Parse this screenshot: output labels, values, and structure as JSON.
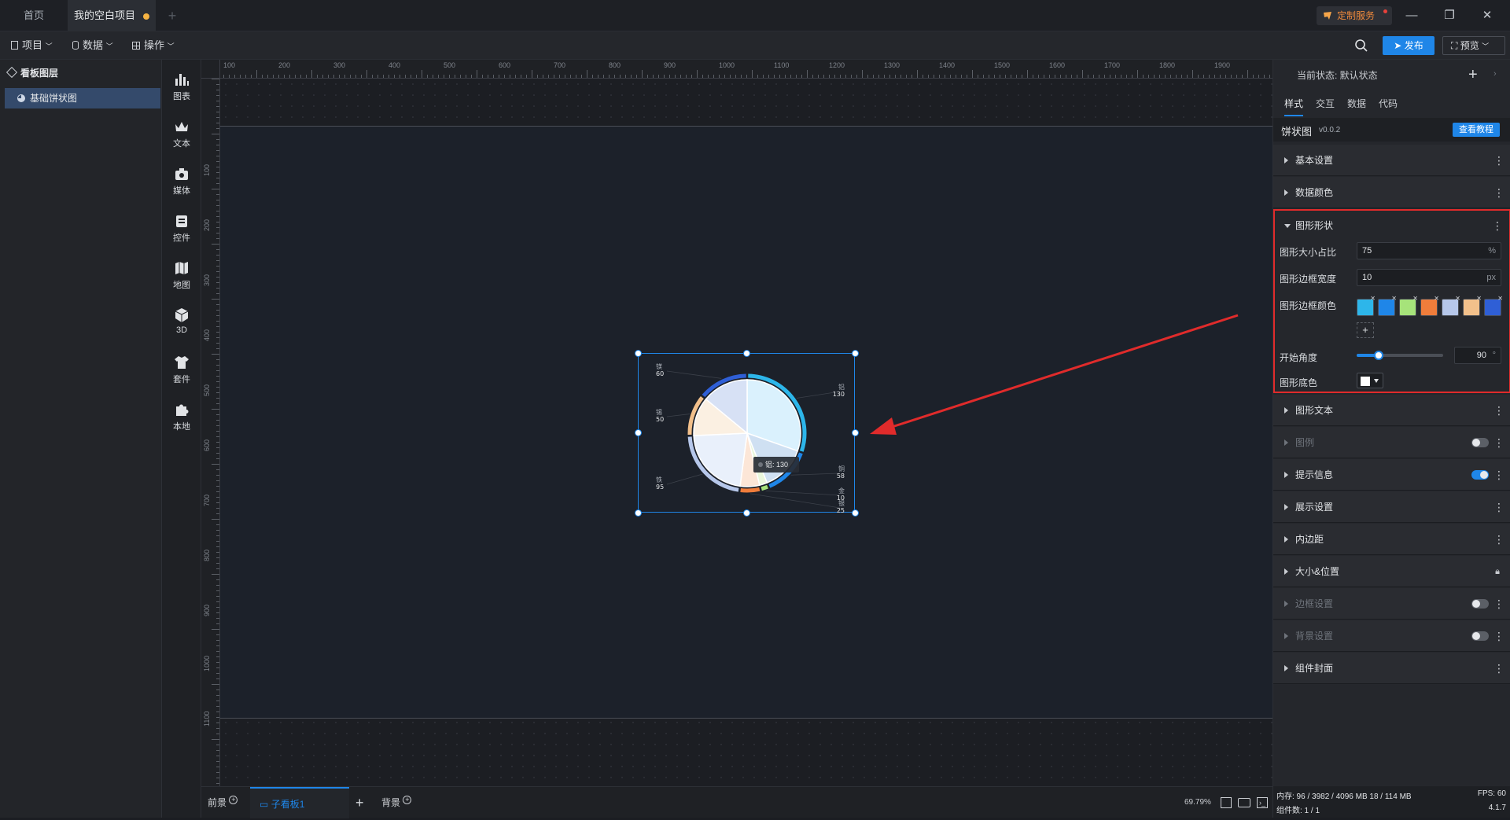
{
  "tabs": {
    "home": "首页",
    "project": "我的空白项目",
    "add": "+"
  },
  "titlebar": {
    "custom_service": "定制服务"
  },
  "toolbar": {
    "menus": [
      "项目",
      "数据",
      "操作"
    ],
    "publish": "发布",
    "preview": "预览"
  },
  "layers": {
    "title": "看板图层",
    "item": "基础饼状图"
  },
  "components": [
    "图表",
    "文本",
    "媒体",
    "控件",
    "地图",
    "3D",
    "套件",
    "本地"
  ],
  "ruler": {
    "top": [
      "100",
      "200",
      "300",
      "400",
      "500",
      "600",
      "700",
      "800",
      "900",
      "1000",
      "1100",
      "1200",
      "1300",
      "1400",
      "1500",
      "1600",
      "1700",
      "1800",
      "1900"
    ],
    "left": [
      "100",
      "200",
      "300",
      "400",
      "500",
      "600",
      "700",
      "800",
      "900",
      "1000",
      "1100"
    ]
  },
  "chart_data": {
    "type": "pie",
    "labels": [
      "铝",
      "铜",
      "金",
      "银",
      "铁",
      "锡",
      "镁"
    ],
    "values": [
      130,
      58,
      10,
      25,
      95,
      50,
      60
    ],
    "start_angle": 90,
    "size_ratio": 75,
    "tooltip": {
      "name": "铝:",
      "value": "130"
    }
  },
  "bottom": {
    "front": "前景",
    "subboard": "子看板1",
    "add": "+",
    "back": "背景",
    "zoom": "69.79%"
  },
  "status": {
    "memory": "内存: 96 / 3982 / 4096 MB 18 / 114 MB",
    "fps": "FPS: 60",
    "count": "组件数: 1 / 1",
    "version": "4.1.7"
  },
  "panel": {
    "state_label": "当前状态: 默认状态",
    "tabs": [
      "样式",
      "交互",
      "数据",
      "代码"
    ],
    "component_name": "饼状图",
    "version": "v0.0.2",
    "tutorial": "查看教程",
    "sections": {
      "basic": "基本设置",
      "datacolor": "数据颜色",
      "shape": "图形形状",
      "text": "图形文本",
      "legend": "图例",
      "tooltip": "提示信息",
      "display": "展示设置",
      "padding": "内边距",
      "sizepos": "大小&位置",
      "border": "边框设置",
      "background": "背景设置",
      "cover": "组件封面"
    },
    "shape": {
      "size_label": "图形大小占比",
      "size_value": "75",
      "size_unit": "%",
      "border_width_label": "图形边框宽度",
      "border_width_value": "10",
      "border_width_unit": "px",
      "border_color_label": "图形边框颜色",
      "colors": [
        "#2db6ea",
        "#1f86e8",
        "#a6e37a",
        "#f07d3b",
        "#b6c7ea",
        "#f2c08b",
        "#2f5fd6"
      ],
      "add": "+",
      "angle_label": "开始角度",
      "angle_value": "90",
      "angle_unit": "°",
      "angle_fraction": 0.25,
      "bg_label": "图形底色",
      "bg_color": "#ffffff"
    }
  }
}
